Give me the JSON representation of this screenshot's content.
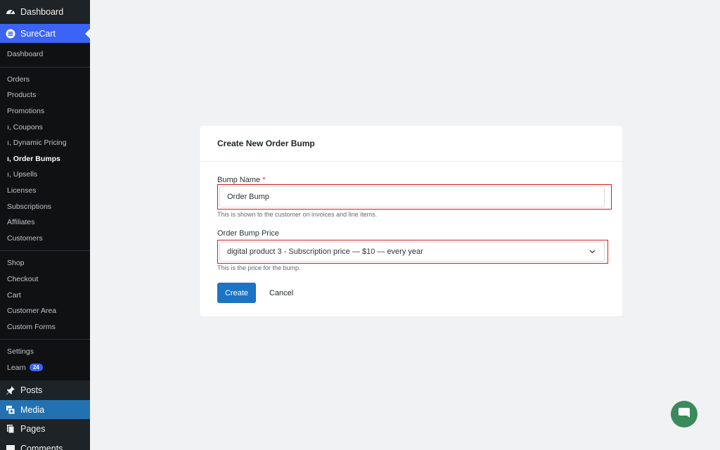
{
  "sidebar": {
    "top": [
      {
        "label": "Dashboard",
        "icon": "dashboard-icon"
      },
      {
        "label": "SureCart",
        "icon": "surecart-icon"
      }
    ],
    "sub_groups": [
      [
        "Dashboard"
      ],
      [
        "Orders",
        "Products",
        "Promotions",
        "ı, Coupons",
        "ı, Dynamic Pricing",
        "ı, Order Bumps",
        "ı, Upsells",
        "Licenses",
        "Subscriptions",
        "Affiliates",
        "Customers"
      ],
      [
        "Shop",
        "Checkout",
        "Cart",
        "Customer Area",
        "Custom Forms"
      ],
      [
        "Settings",
        "Learn"
      ]
    ],
    "current_item": "ı, Order Bumps",
    "learn_badge": "24",
    "wp_menu": [
      {
        "label": "Posts",
        "icon": "pin-icon"
      },
      {
        "label": "Media",
        "icon": "media-icon"
      },
      {
        "label": "Pages",
        "icon": "pages-icon"
      },
      {
        "label": "Comments",
        "icon": "comments-icon"
      }
    ]
  },
  "form": {
    "title": "Create New Order Bump",
    "bump_name_label": "Bump Name",
    "required_mark": "*",
    "bump_name_value": "Order Bump",
    "bump_name_help": "This is shown to the customer on invoices and line items.",
    "price_label": "Order Bump Price",
    "price_value": "digital product 3 - Subscription price — $10 — every year",
    "price_help": "This is the price for the bump.",
    "create_label": "Create",
    "cancel_label": "Cancel"
  },
  "colors": {
    "sidebar_bg": "#1d2327",
    "accent": "#3b63f5",
    "highlight_outline": "#d81b1b",
    "primary_button": "#1b74c4",
    "chat_bubble": "#3a8a5c"
  }
}
